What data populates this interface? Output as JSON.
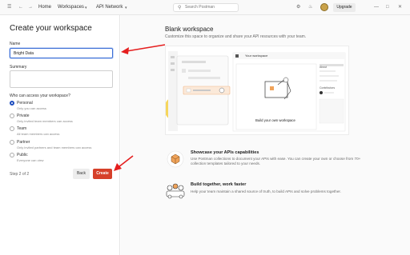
{
  "topbar": {
    "home": "Home",
    "workspaces": "Workspaces",
    "api_network": "API Network",
    "search_placeholder": "Search Postman",
    "upgrade": "Upgrade"
  },
  "form": {
    "title": "Create your workspace",
    "name_label": "Name",
    "name_value": "Bright Data",
    "summary_label": "Summary",
    "summary_value": "",
    "access_label": "Who can access your workspace?",
    "options": [
      {
        "label": "Personal",
        "sub": "Only you can access",
        "selected": true
      },
      {
        "label": "Private",
        "sub": "Only invited team members can access",
        "selected": false
      },
      {
        "label": "Team",
        "sub": "All team members can access",
        "selected": false
      },
      {
        "label": "Partner",
        "sub": "Only invited partners and team members can access",
        "selected": false
      },
      {
        "label": "Public",
        "sub": "Everyone can view",
        "selected": false
      }
    ],
    "step": "Step 2 of 2",
    "back": "Back",
    "create": "Create"
  },
  "preview": {
    "title": "Blank workspace",
    "subtitle": "Customize this space to organize and share your API resources with your team.",
    "illus_workspace": "Your workspace",
    "illus_build": "Build your own workspace",
    "illus_about": "About",
    "illus_contributors": "Contributors"
  },
  "features": [
    {
      "title": "Showcase your APIs capabilities",
      "desc": "Use Postman collections to document your APIs with ease. You can create your own or choose from 70+ collection templates tailored to your needs."
    },
    {
      "title": "Build together, work faster",
      "desc": "Help your team maintain a shared source of truth, to build APIs and solve problems together."
    }
  ],
  "colors": {
    "accent": "#d6402a",
    "focus": "#3b6ed6",
    "radio": "#1f4fbf"
  }
}
